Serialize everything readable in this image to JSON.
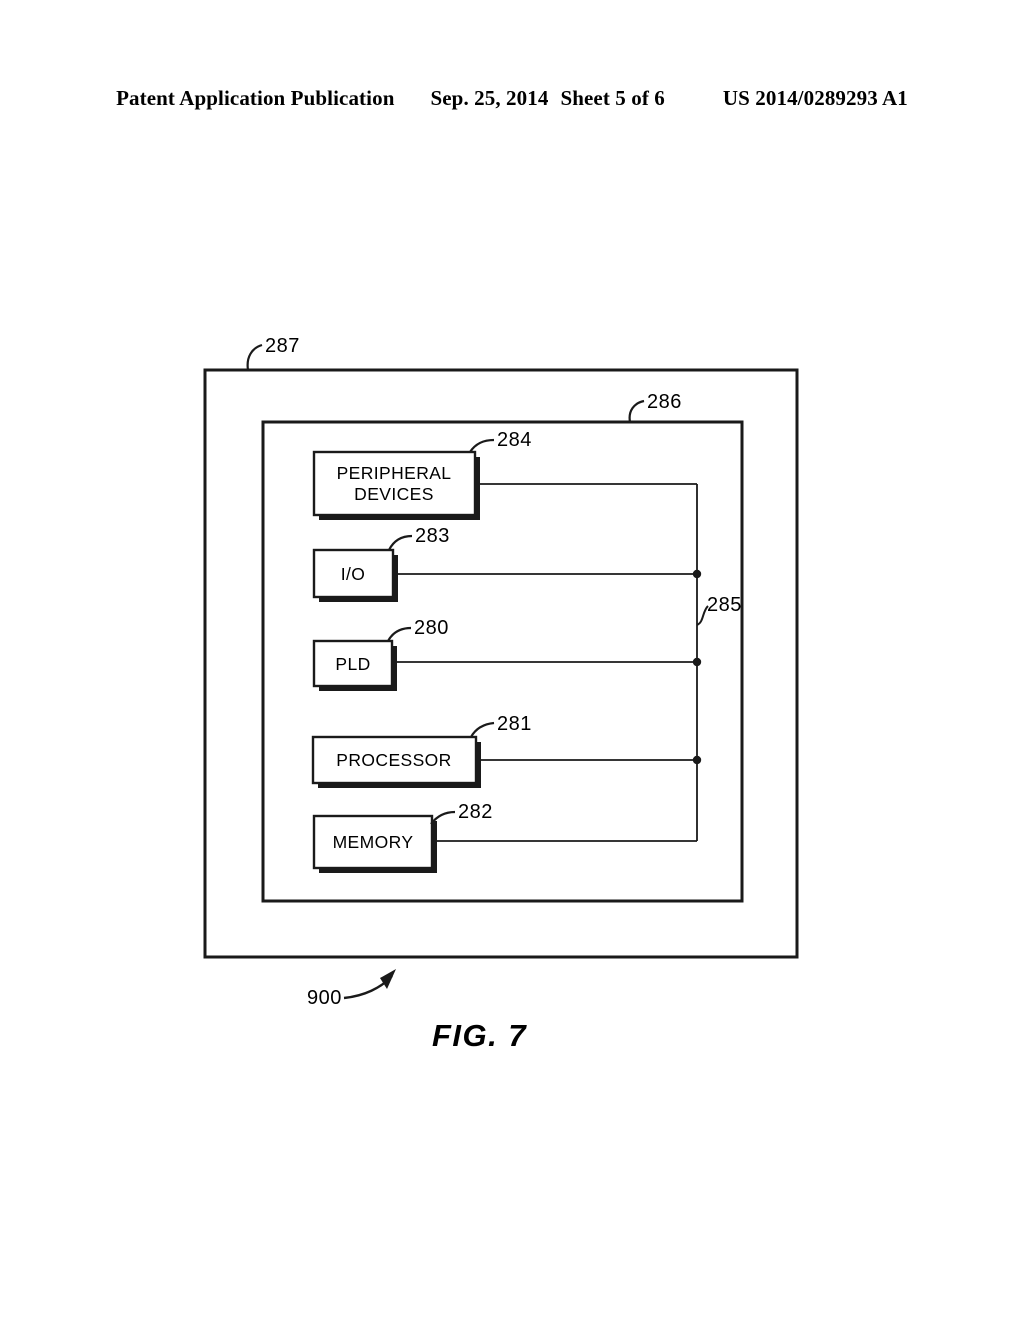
{
  "header": {
    "publication": "Patent Application Publication",
    "date": "Sep. 25, 2014",
    "sheet": "Sheet 5 of 6",
    "patent_number": "US 2014/0289293 A1"
  },
  "figure": {
    "caption": "FIG. 7",
    "system_ref": "900",
    "outer_box_ref": "287",
    "inner_box_ref": "286",
    "bus_ref": "285",
    "blocks": [
      {
        "label_line1": "PERIPHERAL",
        "label_line2": "DEVICES",
        "ref": "284"
      },
      {
        "label_line1": "I/O",
        "label_line2": "",
        "ref": "283"
      },
      {
        "label_line1": "PLD",
        "label_line2": "",
        "ref": "280"
      },
      {
        "label_line1": "PROCESSOR",
        "label_line2": "",
        "ref": "281"
      },
      {
        "label_line1": "MEMORY",
        "label_line2": "",
        "ref": "282"
      }
    ]
  },
  "colors": {
    "ink": "#1a1a1a",
    "paper": "#ffffff"
  }
}
